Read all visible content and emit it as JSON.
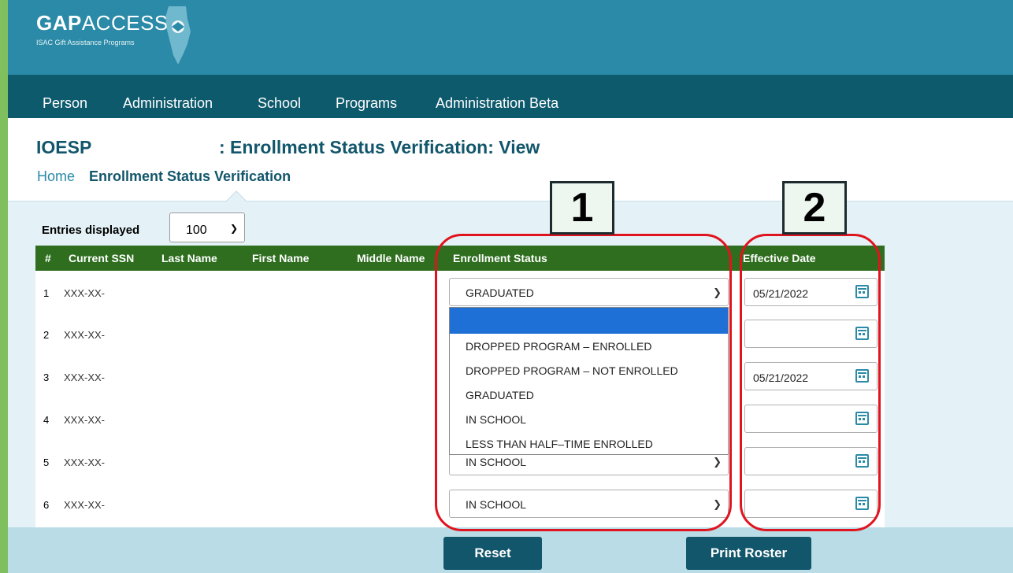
{
  "app": {
    "brand_bold": "GAP",
    "brand_light": "ACCESS",
    "tagline": "ISAC Gift Assistance Programs"
  },
  "nav": {
    "items": [
      "Person",
      "Administration",
      "School",
      "Programs",
      "Administration Beta"
    ]
  },
  "page": {
    "code": "IOESP",
    "title": ": Enrollment Status Verification: View"
  },
  "breadcrumb": {
    "home": "Home",
    "current": "Enrollment Status Verification"
  },
  "entries": {
    "label": "Entries displayed",
    "value": "100"
  },
  "table": {
    "headers": [
      "#",
      "Current SSN",
      "Last Name",
      "First Name",
      "Middle Name",
      "Enrollment Status",
      "Effective Date"
    ],
    "rows": [
      {
        "num": "1",
        "ssn": "XXX-XX-",
        "status": "GRADUATED",
        "date": "05/21/2022"
      },
      {
        "num": "2",
        "ssn": "XXX-XX-",
        "status": "",
        "date": ""
      },
      {
        "num": "3",
        "ssn": "XXX-XX-",
        "status": "",
        "date": "05/21/2022"
      },
      {
        "num": "4",
        "ssn": "XXX-XX-",
        "status": "",
        "date": ""
      },
      {
        "num": "5",
        "ssn": "XXX-XX-",
        "status": "IN SCHOOL",
        "date": ""
      },
      {
        "num": "6",
        "ssn": "XXX-XX-",
        "status": "IN SCHOOL",
        "date": ""
      }
    ]
  },
  "dropdown": {
    "options": [
      "",
      "DROPPED PROGRAM – ENROLLED",
      "DROPPED PROGRAM – NOT ENROLLED",
      "GRADUATED",
      "IN SCHOOL",
      "LESS THAN HALF–TIME ENROLLED"
    ],
    "highlight_color": "#1e6fd6"
  },
  "callouts": {
    "label_1": "1",
    "label_2": "2",
    "color": "#e0141e"
  },
  "buttons": {
    "reset": "Reset",
    "print_roster": "Print Roster"
  },
  "colors": {
    "header": "#2a8aa7",
    "nav": "#0e5a6d",
    "table_header": "#2e6e1e",
    "title": "#12566b"
  }
}
